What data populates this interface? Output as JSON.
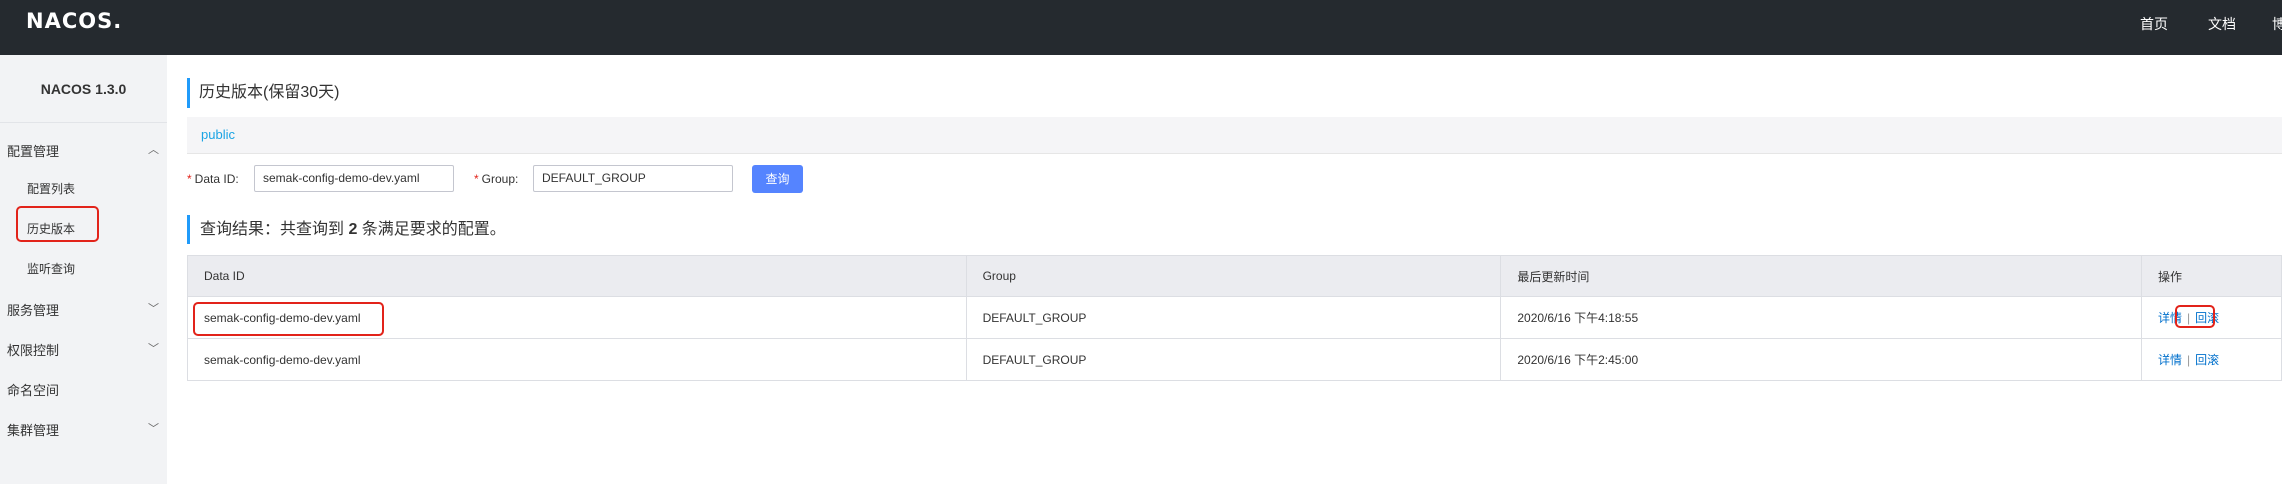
{
  "header": {
    "logo": "NACOS.",
    "nav": [
      "首页",
      "文档",
      "博"
    ]
  },
  "sidebar": {
    "version": "NACOS 1.3.0",
    "groups": [
      {
        "label": "配置管理",
        "expanded": true,
        "items": [
          "配置列表",
          "历史版本",
          "监听查询"
        ]
      },
      {
        "label": "服务管理",
        "expanded": false
      },
      {
        "label": "权限控制",
        "expanded": false
      },
      {
        "label": "命名空间"
      },
      {
        "label": "集群管理",
        "expanded": false
      }
    ],
    "active_item": "历史版本"
  },
  "main": {
    "title": "历史版本(保留30天)",
    "namespace": "public",
    "form": {
      "data_id_label": "Data ID:",
      "data_id_value": "semak-config-demo-dev.yaml",
      "group_label": "Group:",
      "group_value": "DEFAULT_GROUP",
      "query_label": "查询"
    },
    "result": {
      "prefix": "查询结果：共查询到 ",
      "count": "2",
      "suffix": " 条满足要求的配置。"
    },
    "table": {
      "columns": [
        "Data ID",
        "Group",
        "最后更新时间",
        "操作"
      ],
      "rows": [
        {
          "data_id": "semak-config-demo-dev.yaml",
          "group": "DEFAULT_GROUP",
          "time": "2020/6/16 下午4:18:55",
          "detail": "详情",
          "sep": "|",
          "rollback": "回滚"
        },
        {
          "data_id": "semak-config-demo-dev.yaml",
          "group": "DEFAULT_GROUP",
          "time": "2020/6/16 下午2:45:00",
          "detail": "详情",
          "sep": "|",
          "rollback": "回滚"
        }
      ]
    }
  },
  "colors": {
    "topbar": "#252a2f",
    "sidebar": "#f2f3f5",
    "accent": "#209bfa",
    "button": "#5584ff",
    "link": "#0070cc",
    "highlight": "#e2231a"
  }
}
